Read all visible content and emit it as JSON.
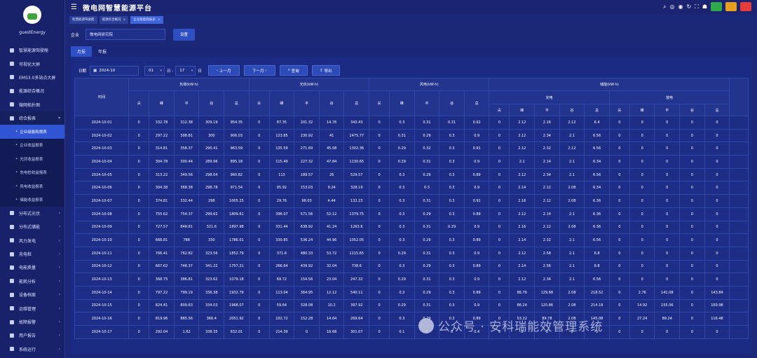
{
  "app": {
    "title": "微电网智慧能源平台",
    "user": "guestEnergy"
  },
  "sidebar": {
    "items": [
      {
        "label": "智慧能源驾驶舱"
      },
      {
        "label": "可视化大屏"
      },
      {
        "label": "EMS3.0多站点大屏"
      },
      {
        "label": "能源综合概况"
      },
      {
        "label": "微网拓扑图"
      },
      {
        "label": "综合报表",
        "open": true
      }
    ],
    "subitems": [
      {
        "label": "企业级能耗报表",
        "active": true
      },
      {
        "label": "企业收益报表"
      },
      {
        "label": "光伏收益报表"
      },
      {
        "label": "充电桩收益报表"
      },
      {
        "label": "风电收益报表"
      },
      {
        "label": "储能收益报表"
      }
    ],
    "items2": [
      {
        "label": "分布式光伏"
      },
      {
        "label": "分布式储能"
      },
      {
        "label": "风力发电"
      },
      {
        "label": "充电桩"
      },
      {
        "label": "电能质量"
      },
      {
        "label": "能耗分析"
      },
      {
        "label": "设备档案"
      },
      {
        "label": "运维管理"
      },
      {
        "label": "故障报警"
      },
      {
        "label": "用户报告"
      },
      {
        "label": "系统运行"
      }
    ]
  },
  "tabs": [
    {
      "label": "智慧能源驾驶舱",
      "active": false,
      "closable": false
    },
    {
      "label": "能源综合概况",
      "active": false,
      "closable": true
    },
    {
      "label": "企业级能耗报表",
      "active": true,
      "closable": true
    }
  ],
  "filter": {
    "label": "企业",
    "value": "微电网研究院",
    "button": "设置"
  },
  "report_tabs": [
    "月报",
    "年报"
  ],
  "query": {
    "date_label": "日期",
    "date_value": "2024-10",
    "day_from": "01",
    "day_sep": "日 -",
    "day_to": "17",
    "day_suffix": "日",
    "prev": "上一月",
    "next": "下一月",
    "search": "查询",
    "export": "导出"
  },
  "table": {
    "time_header": "时间",
    "groups": [
      "负荷(kW·h)",
      "光伏(kW·h)",
      "风电(kW·h)",
      "储能(kW·h)"
    ],
    "storage_sub": [
      "充电",
      "放电"
    ],
    "period_cols": [
      "尖",
      "峰",
      "平",
      "谷",
      "总"
    ],
    "rows": [
      [
        "2024-10-01",
        "0",
        "332.78",
        "312.38",
        "309.19",
        "954.35",
        "0",
        "87.35",
        "201.32",
        "14.76",
        "343.43",
        "0",
        "0.3",
        "0.31",
        "0.31",
        "0.92",
        "0",
        "2.12",
        "2.16",
        "2.12",
        "6.4",
        "0",
        "0",
        "0",
        "0",
        "0"
      ],
      [
        "2024-10-02",
        "0",
        "297.22",
        "308.81",
        "300",
        "906.03",
        "0",
        "123.85",
        "230.92",
        "41",
        "1475.77",
        "0",
        "0.31",
        "0.29",
        "0.3",
        "0.9",
        "0",
        "2.12",
        "2.34",
        "2.1",
        "6.56",
        "0",
        "0",
        "0",
        "0",
        "0"
      ],
      [
        "2024-10-03",
        "0",
        "314.81",
        "358.37",
        "290.41",
        "963.59",
        "0",
        "135.59",
        "271.69",
        "45.08",
        "1302.36",
        "0",
        "0.29",
        "0.32",
        "0.3",
        "0.91",
        "0",
        "2.12",
        "2.32",
        "2.12",
        "6.56",
        "0",
        "0",
        "0",
        "0",
        "0"
      ],
      [
        "2024-10-04",
        "0",
        "304.78",
        "300.44",
        "289.96",
        "895.18",
        "0",
        "115.49",
        "227.32",
        "47.84",
        "1130.65",
        "0",
        "0.29",
        "0.31",
        "0.3",
        "0.9",
        "0",
        "2.1",
        "2.14",
        "2.1",
        "6.34",
        "0",
        "0",
        "0",
        "0",
        "0"
      ],
      [
        "2024-10-05",
        "0",
        "313.22",
        "349.56",
        "298.04",
        "960.82",
        "0",
        "113",
        "189.57",
        "26",
        "529.57",
        "0",
        "0.3",
        "0.29",
        "0.3",
        "0.89",
        "0",
        "2.12",
        "2.34",
        "2.1",
        "6.56",
        "0",
        "0",
        "0",
        "0",
        "0"
      ],
      [
        "2024-10-06",
        "0",
        "304.38",
        "368.38",
        "298.78",
        "971.54",
        "0",
        "95.92",
        "153.03",
        "9.24",
        "328.19",
        "0",
        "0.3",
        "0.3",
        "0.3",
        "0.9",
        "0",
        "2.14",
        "2.12",
        "2.08",
        "6.34",
        "0",
        "0",
        "0",
        "0",
        "0"
      ],
      [
        "2024-10-07",
        "0",
        "374.81",
        "332.44",
        "298",
        "1005.25",
        "0",
        "29.76",
        "98.03",
        "4.44",
        "132.23",
        "0",
        "0.3",
        "0.31",
        "0.3",
        "0.91",
        "0",
        "2.16",
        "2.12",
        "2.08",
        "6.36",
        "0",
        "0",
        "0",
        "0",
        "0"
      ],
      [
        "2024-10-08",
        "0",
        "755.62",
        "754.37",
        "299.62",
        "1809.61",
        "0",
        "396.07",
        "571.56",
        "52.12",
        "1379.75",
        "0",
        "0.3",
        "0.29",
        "0.3",
        "0.89",
        "0",
        "2.12",
        "2.14",
        "2.1",
        "6.36",
        "0",
        "0",
        "0",
        "0",
        "0"
      ],
      [
        "2024-10-09",
        "0",
        "727.57",
        "848.81",
        "321.6",
        "1897.98",
        "0",
        "331.44",
        "638.92",
        "41.24",
        "1263.6",
        "0",
        "0.3",
        "0.31",
        "0.29",
        "0.9",
        "0",
        "2.16",
        "2.12",
        "2.08",
        "6.36",
        "0",
        "0",
        "0",
        "0",
        "0"
      ],
      [
        "2024-10-10",
        "0",
        "668.81",
        "788",
        "330",
        "1786.01",
        "0",
        "330.85",
        "536.24",
        "44.96",
        "1052.05",
        "0",
        "0.3",
        "0.29",
        "0.3",
        "0.89",
        "0",
        "2.14",
        "2.32",
        "2.1",
        "6.56",
        "0",
        "0",
        "0",
        "0",
        "0"
      ],
      [
        "2024-10-11",
        "0",
        "766.41",
        "762.82",
        "323.56",
        "1852.79",
        "0",
        "371.6",
        "480.33",
        "53.72",
        "1115.65",
        "0",
        "0.29",
        "0.31",
        "0.3",
        "0.9",
        "0",
        "2.12",
        "2.58",
        "2.1",
        "6.8",
        "0",
        "0",
        "0",
        "0",
        "0"
      ],
      [
        "2024-10-12",
        "0",
        "667.62",
        "748.37",
        "341.22",
        "1757.21",
        "0",
        "266.64",
        "439.92",
        "32.04",
        "738.6",
        "0",
        "0.3",
        "0.29",
        "0.3",
        "0.89",
        "0",
        "2.14",
        "2.56",
        "2.1",
        "6.8",
        "0",
        "0",
        "0",
        "0",
        "0"
      ],
      [
        "2024-10-13",
        "0",
        "368.75",
        "386.81",
        "323.62",
        "1079.18",
        "0",
        "69.72",
        "154.56",
        "23.04",
        "247.32",
        "0",
        "0.29",
        "0.31",
        "0.3",
        "0.9",
        "0",
        "2.12",
        "2.34",
        "2.1",
        "6.56",
        "0",
        "0",
        "0",
        "0",
        "0"
      ],
      [
        "2024-10-14",
        "0",
        "797.22",
        "799.19",
        "336.38",
        "1932.79",
        "0",
        "113.04",
        "364.95",
        "12.12",
        "540.11",
        "0",
        "0.3",
        "0.29",
        "0.3",
        "0.89",
        "0",
        "86.76",
        "129.68",
        "2.08",
        "218.52",
        "0",
        "2.76",
        "141.08",
        "0",
        "143.84"
      ],
      [
        "2024-10-15",
        "0",
        "824.41",
        "809.63",
        "334.03",
        "1968.07",
        "0",
        "59.64",
        "328.08",
        "10.2",
        "397.92",
        "0",
        "0.29",
        "0.31",
        "0.3",
        "0.9",
        "0",
        "86.24",
        "125.86",
        "2.08",
        "214.18",
        "0",
        "14.92",
        "155.06",
        "0",
        "169.98"
      ],
      [
        "2024-10-16",
        "0",
        "819.96",
        "865.56",
        "366.4",
        "2051.92",
        "0",
        "102.72",
        "152.28",
        "14.64",
        "269.64",
        "0",
        "0.3",
        "0.29",
        "0.3",
        "0.89",
        "0",
        "53.22",
        "89.78",
        "2.08",
        "145.08",
        "0",
        "27.24",
        "89.24",
        "0",
        "116.48"
      ],
      [
        "2024-10-17",
        "0",
        "292.04",
        "1.62",
        "338.35",
        "632.01",
        "0",
        "214.39",
        "0",
        "16.68",
        "301.07",
        "0",
        "0.1",
        "0",
        "0",
        "0.4",
        "0",
        "0",
        "0",
        "0",
        "0",
        "0",
        "0",
        "0",
        "0",
        "0"
      ]
    ]
  },
  "watermark": "公众号 · 安科瑞能效管理系统"
}
